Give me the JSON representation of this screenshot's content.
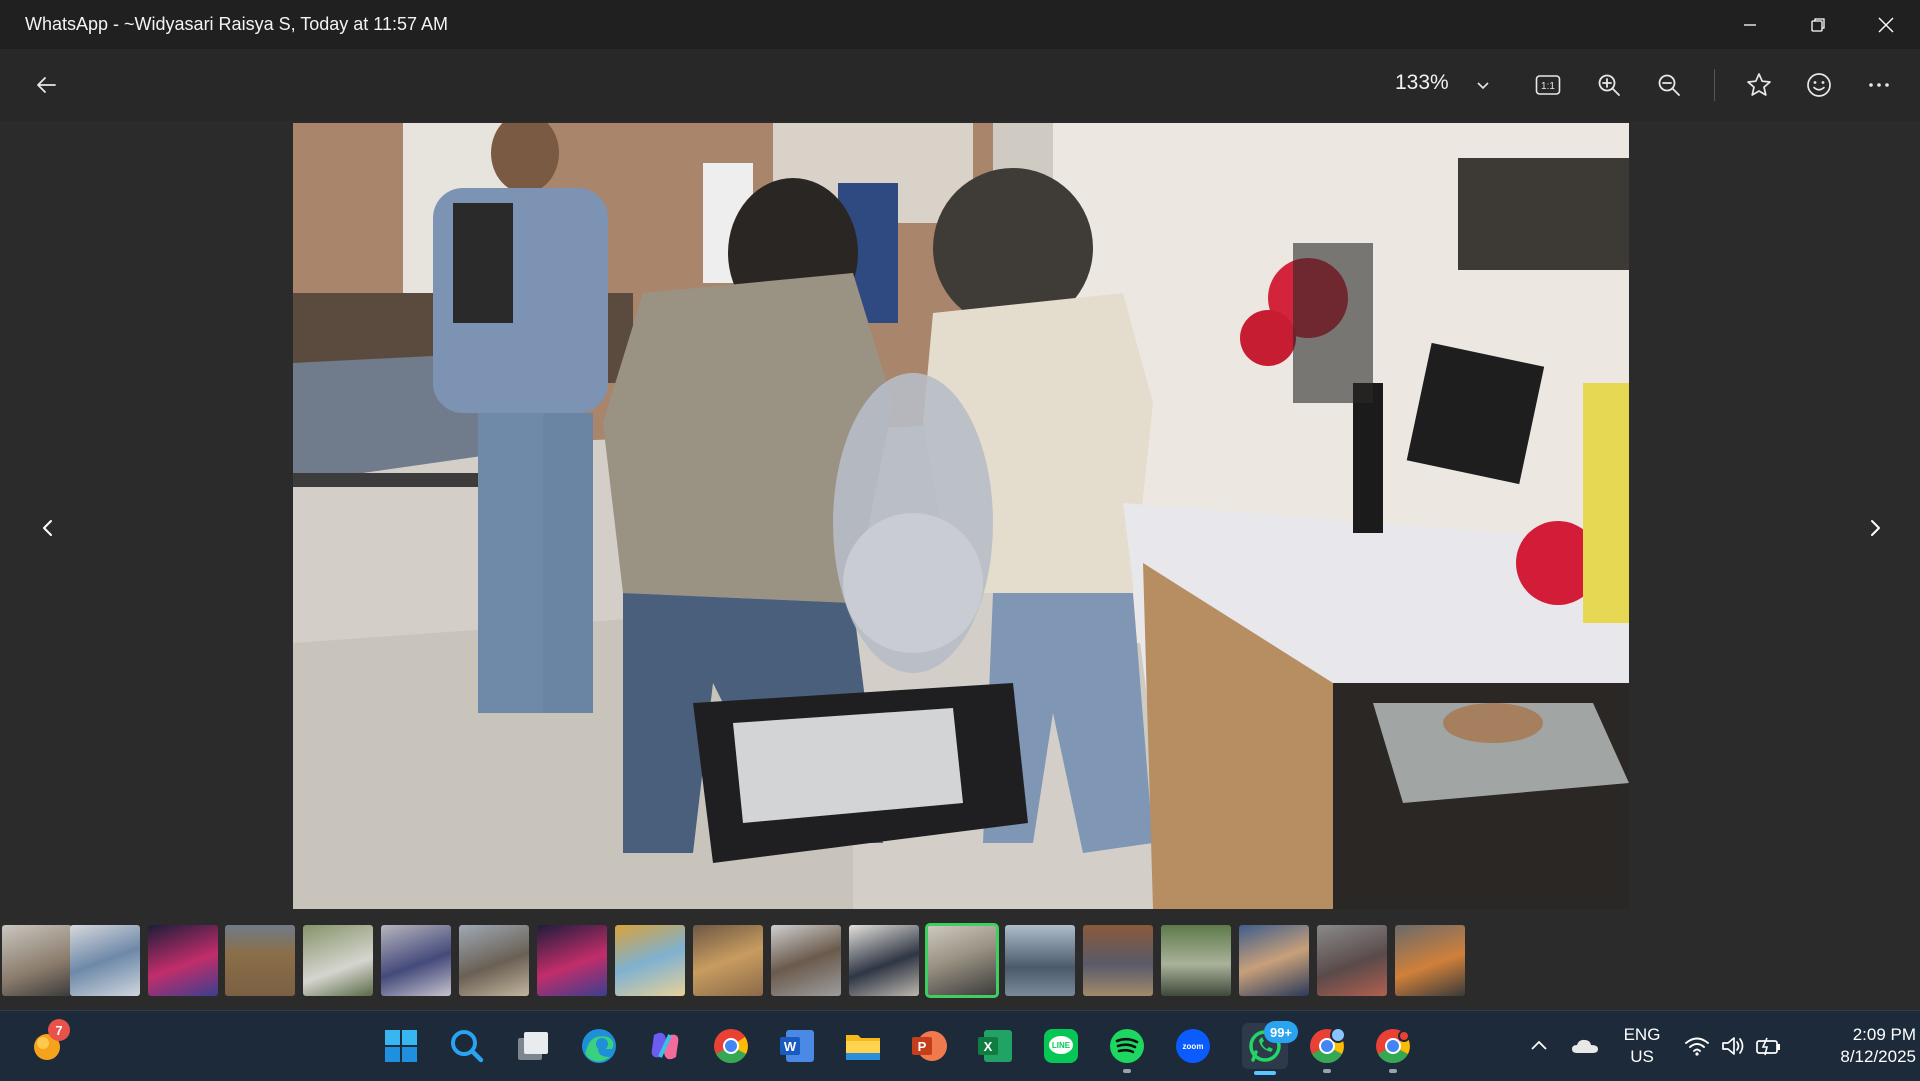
{
  "window": {
    "title": "WhatsApp - ~Widyasari Raisya S, Today at 11:57 AM"
  },
  "toolbar": {
    "zoom": "133%",
    "actual_size_label": "1:1"
  },
  "filmstrip": {
    "count": 19,
    "selected_index": 12
  },
  "taskbar": {
    "weather_badge": "7",
    "whatsapp_badge": "99+",
    "lang_line1": "ENG",
    "lang_line2": "US",
    "time": "2:09 PM",
    "date": "8/12/2025"
  },
  "colors": {
    "accent_green": "#3fcf60",
    "taskbar_bg": "#1c2a3a",
    "titlebar_bg": "#202020"
  }
}
